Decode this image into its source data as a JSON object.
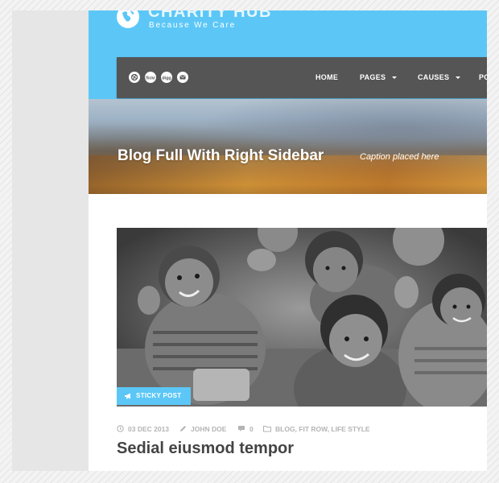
{
  "site": {
    "title": "CHARITY HUB",
    "tagline": "Because We Care"
  },
  "social_icons": [
    "dribbble-icon",
    "flickr-icon",
    "digg-icon",
    "email-icon"
  ],
  "nav": {
    "items": [
      {
        "label": "HOME",
        "dropdown": false
      },
      {
        "label": "PAGES",
        "dropdown": true
      },
      {
        "label": "CAUSES",
        "dropdown": true
      },
      {
        "label": "PO",
        "dropdown": false
      }
    ]
  },
  "page": {
    "title": "Blog Full With Right Sidebar",
    "caption": "Caption placed here"
  },
  "post": {
    "badge": "STICKY POST",
    "date": "03 DEC 2013",
    "author": "JOHN DOE",
    "comments": "0",
    "categories": "BLOG, FIT ROW, LIFE STYLE",
    "title": "Sedial eiusmod tempor"
  },
  "colors": {
    "header": "#5cc7f7",
    "nav_bar": "#555555",
    "accent": "#5cc7f7",
    "title_text": "#444444",
    "meta_text": "#b4b4b4"
  }
}
